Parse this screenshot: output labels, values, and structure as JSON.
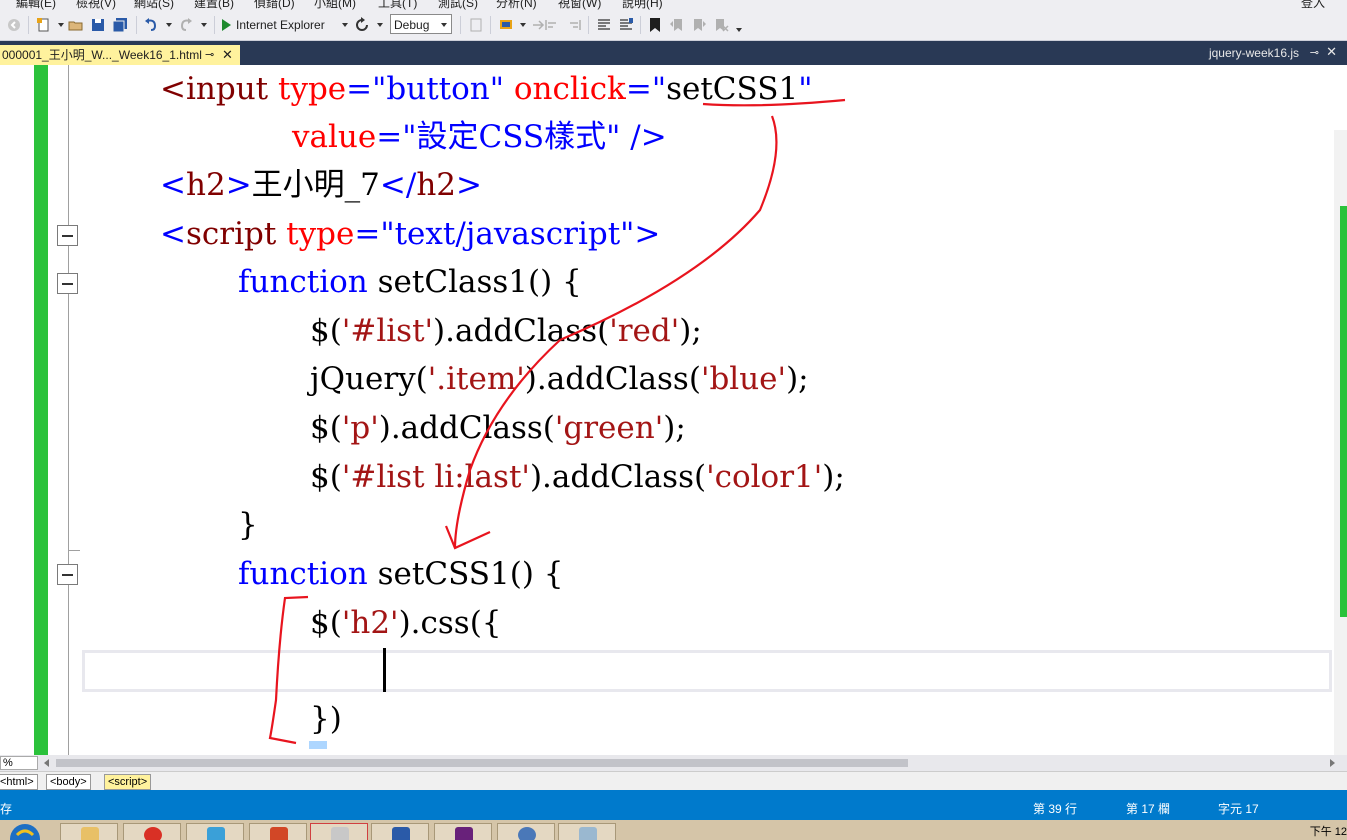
{
  "menu": {
    "items": [
      "編輯(E)",
      "檢視(V)",
      "網站(S)",
      "建置(B)",
      "偵錯(D)",
      "小組(M)",
      "工具(T)",
      "測試(S)",
      "分析(N)",
      "視窗(W)",
      "說明(H)"
    ],
    "login": "登入"
  },
  "toolbar": {
    "run_target": "Internet Explorer",
    "configuration": "Debug"
  },
  "tabs": {
    "active": "000001_王小明_W..._Week16_1.html",
    "right": "jquery-week16.js"
  },
  "code_lines": [
    "<input type=\"button\" onclick=\"setCSS1\"",
    "value=\"設定CSS樣式\" />",
    "<h2>王小明_7</h2>",
    "<script type=\"text/javascript\">",
    "function setClass1() {",
    "$('#list').addClass('red');",
    "jQuery('.item').addClass('blue');",
    "$('p').addClass('green');",
    "$('#list li:last').addClass('color1');",
    "}",
    "function setCSS1() {",
    "$('h2').css({",
    "",
    "})"
  ],
  "zoom": "%",
  "breadcrumbs": [
    "<html>",
    "<body>",
    "<script>"
  ],
  "status": {
    "left": "存",
    "line": "第 39 行",
    "col": "第 17 欄",
    "ch": "字元 17"
  },
  "taskbar": {
    "clock": "下午 12"
  },
  "colors": {
    "status_bar": "#007acc",
    "active_tab": "#fff29d",
    "change_bar": "#2bc23b",
    "annotation": "#e8141e"
  }
}
